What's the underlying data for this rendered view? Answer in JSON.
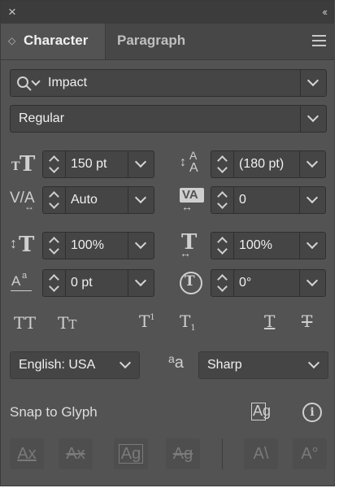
{
  "window": {
    "close": "×",
    "collapse": "‹‹"
  },
  "tabs": [
    {
      "label": "Character",
      "active": true
    },
    {
      "label": "Paragraph",
      "active": false
    }
  ],
  "font": {
    "family": "Impact",
    "style": "Regular"
  },
  "metrics": {
    "font_size": "150 pt",
    "leading": "(180 pt)",
    "kerning": "Auto",
    "tracking": "0",
    "vertical_scale": "100%",
    "horizontal_scale": "100%",
    "baseline_shift": "0 pt",
    "rotation": "0°"
  },
  "language": {
    "value": "English: USA"
  },
  "antialias": {
    "glyph": "a",
    "value": "Sharp"
  },
  "snap": {
    "label": "Snap to Glyph"
  },
  "colors": {
    "panel": "#535353",
    "field": "#454545",
    "text": "#e6e6e6"
  }
}
